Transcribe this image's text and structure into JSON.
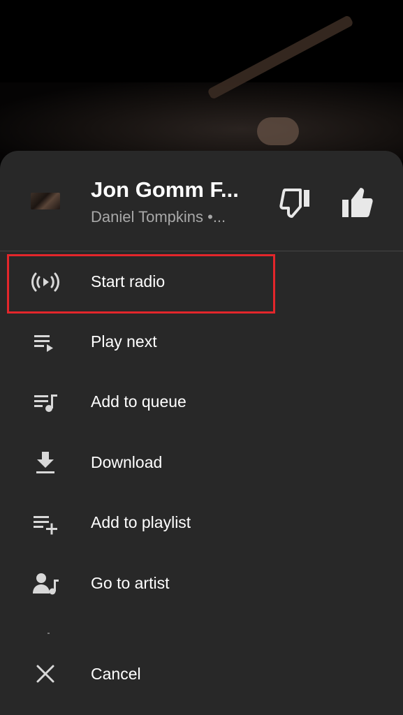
{
  "now_playing": {
    "title": "Jon Gomm F...",
    "subtitle": "Daniel Tompkins •..."
  },
  "actions": {
    "dislike": "thumb-down-icon",
    "like": "thumb-up-icon"
  },
  "menu": [
    {
      "label": "Start radio",
      "icon": "radio-icon"
    },
    {
      "label": "Play next",
      "icon": "play-next-icon"
    },
    {
      "label": "Add to queue",
      "icon": "queue-music-icon"
    },
    {
      "label": "Download",
      "icon": "download-icon"
    },
    {
      "label": "Add to playlist",
      "icon": "playlist-add-icon"
    },
    {
      "label": "Go to artist",
      "icon": "artist-icon"
    },
    {
      "label": "Cancel",
      "icon": "close-icon"
    }
  ],
  "colors": {
    "sheet": "#282828",
    "highlight": "#e3262b",
    "subtitle": "#a8a8a8"
  }
}
